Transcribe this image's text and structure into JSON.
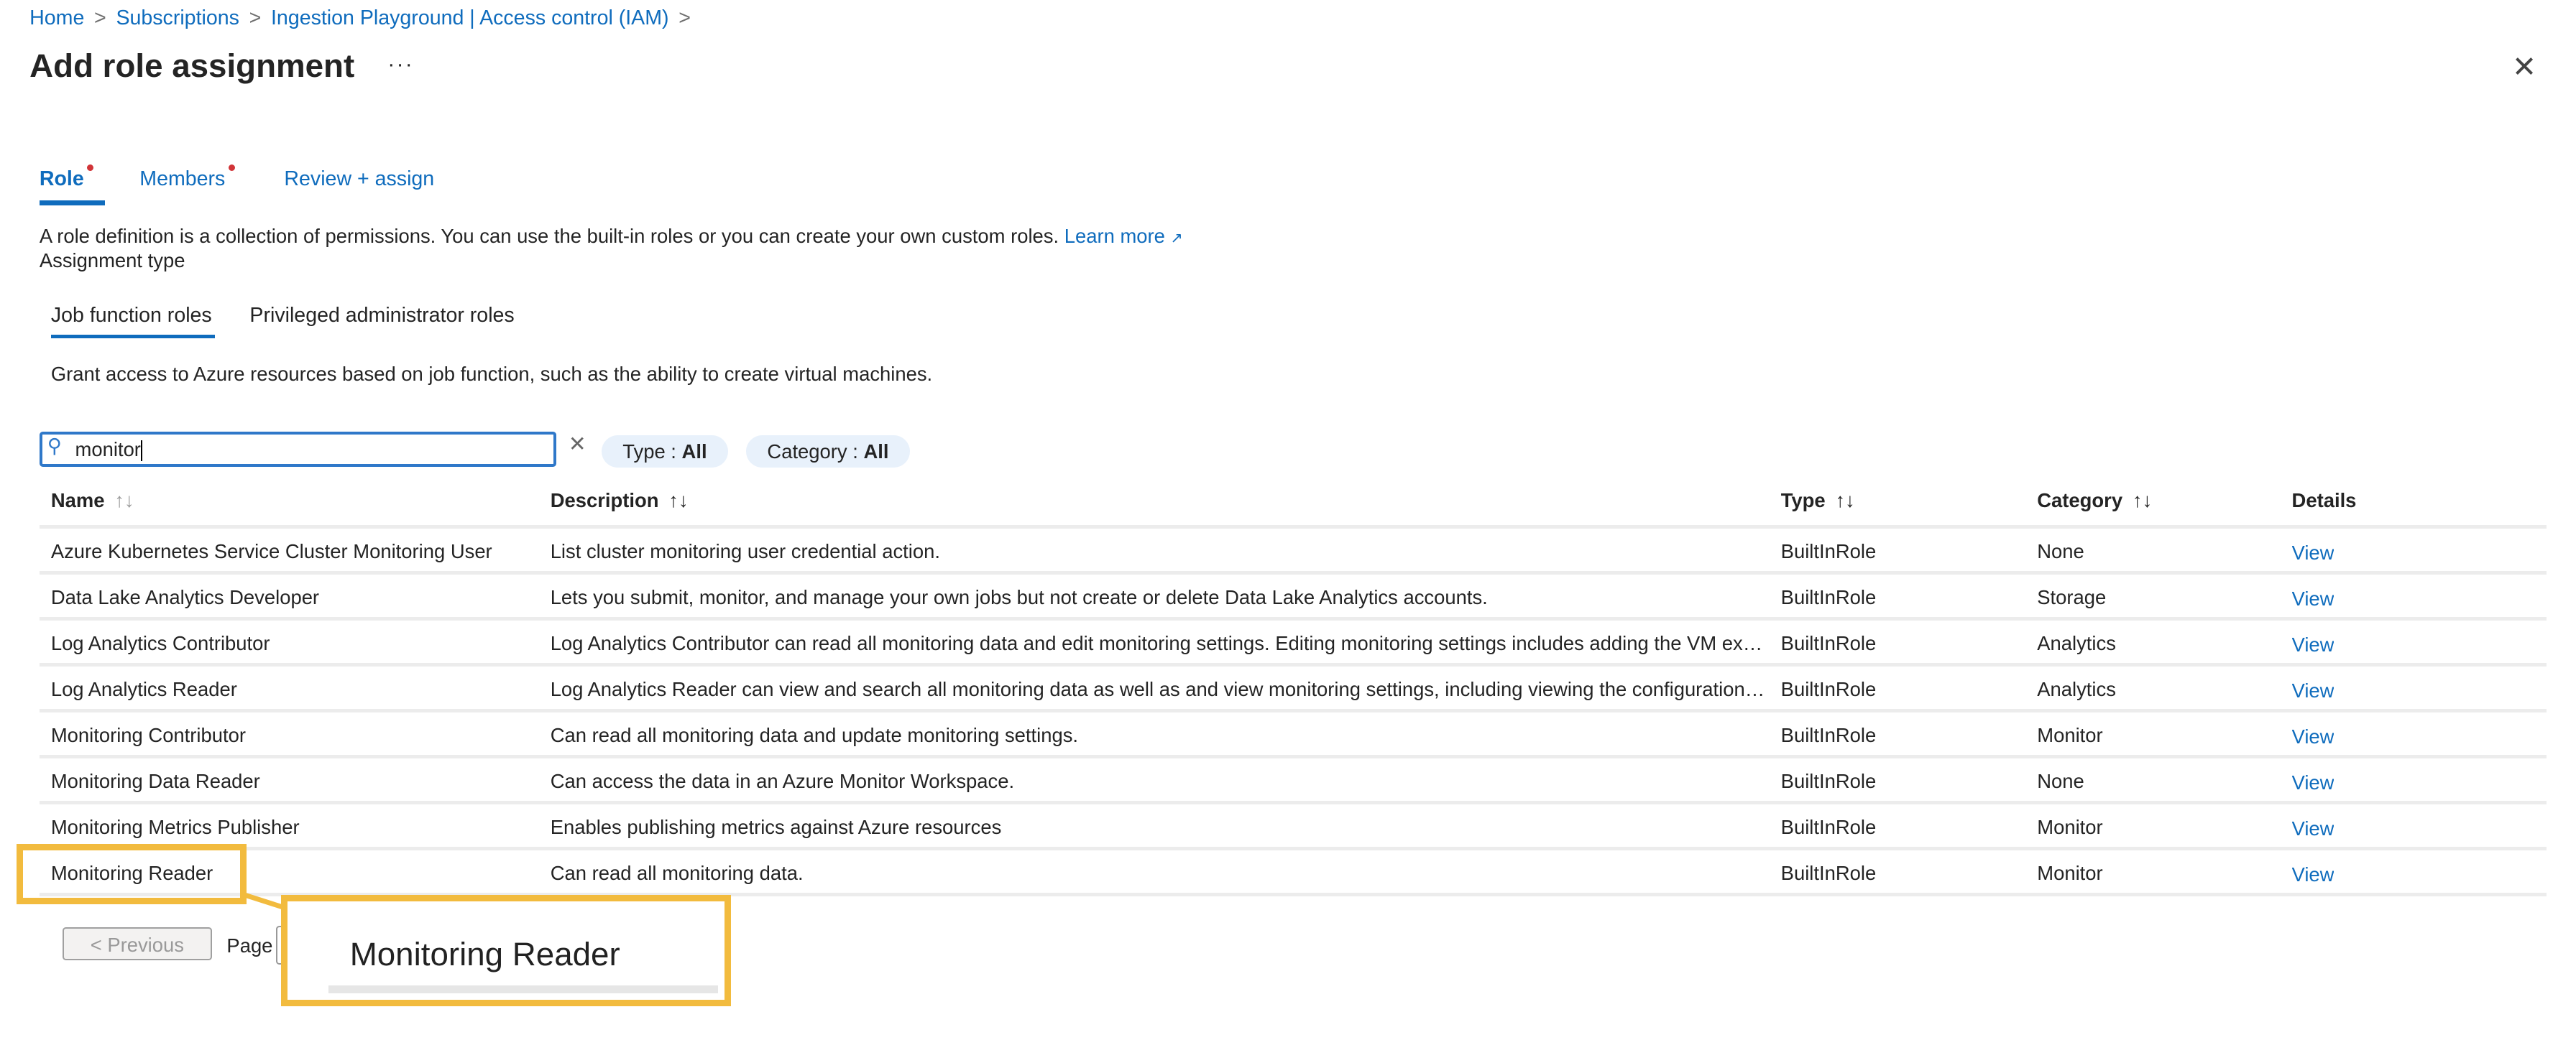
{
  "breadcrumb": [
    "Home",
    "Subscriptions",
    "Ingestion Playground | Access control (IAM)"
  ],
  "breadcrumb_sep": ">",
  "title": "Add role assignment",
  "more_label": "···",
  "close_label": "✕",
  "tabs": [
    {
      "label": "Role",
      "required": true,
      "active": true
    },
    {
      "label": "Members",
      "required": true
    },
    {
      "label": "Review + assign"
    }
  ],
  "description": "A role definition is a collection of permissions. You can use the built-in roles or you can create your own custom roles.",
  "learn_more": "Learn more",
  "external_icon": "↗",
  "assignment_type_label": "Assignment type",
  "subtabs": [
    {
      "label": "Job function roles",
      "active": true
    },
    {
      "label": "Privileged administrator roles"
    }
  ],
  "subtab_description": "Grant access to Azure resources based on job function, such as the ability to create virtual machines.",
  "search": {
    "value": "monitor",
    "icon": "search-icon",
    "clear": "✕"
  },
  "filters": [
    {
      "label": "Type : ",
      "value": "All"
    },
    {
      "label": "Category : ",
      "value": "All"
    }
  ],
  "columns": [
    "Name",
    "Description",
    "Type",
    "Category",
    "Details"
  ],
  "sort_icon": "↑↓",
  "rows": [
    {
      "name": "Azure Kubernetes Service Cluster Monitoring User",
      "description": "List cluster monitoring user credential action.",
      "type": "BuiltInRole",
      "category": "None",
      "details": "View"
    },
    {
      "name": "Data Lake Analytics Developer",
      "description": "Lets you submit, monitor, and manage your own jobs but not create or delete Data Lake Analytics accounts.",
      "type": "BuiltInRole",
      "category": "Storage",
      "details": "View"
    },
    {
      "name": "Log Analytics Contributor",
      "description": "Log Analytics Contributor can read all monitoring data and edit monitoring settings. Editing monitoring settings includes adding the VM extensio...",
      "type": "BuiltInRole",
      "category": "Analytics",
      "details": "View"
    },
    {
      "name": "Log Analytics Reader",
      "description": "Log Analytics Reader can view and search all monitoring data as well as and view monitoring settings, including viewing the configuration of Azur...",
      "type": "BuiltInRole",
      "category": "Analytics",
      "details": "View"
    },
    {
      "name": "Monitoring Contributor",
      "description": "Can read all monitoring data and update monitoring settings.",
      "type": "BuiltInRole",
      "category": "Monitor",
      "details": "View"
    },
    {
      "name": "Monitoring Data Reader",
      "description": "Can access the data in an Azure Monitor Workspace.",
      "type": "BuiltInRole",
      "category": "None",
      "details": "View"
    },
    {
      "name": "Monitoring Metrics Publisher",
      "description": "Enables publishing metrics against Azure resources",
      "type": "BuiltInRole",
      "category": "Monitor",
      "details": "View"
    },
    {
      "name": "Monitoring Reader",
      "description": "Can read all monitoring data.",
      "type": "BuiltInRole",
      "category": "Monitor",
      "details": "View"
    }
  ],
  "pagination": {
    "previous": "< Previous",
    "page_label": "Page"
  },
  "callout": {
    "text": "Monitoring Reader",
    "color": "#f2bb3e"
  },
  "colors": {
    "accent": "#0f6cbd",
    "required_dot": "#d13438",
    "highlight": "#f2bb3e"
  }
}
